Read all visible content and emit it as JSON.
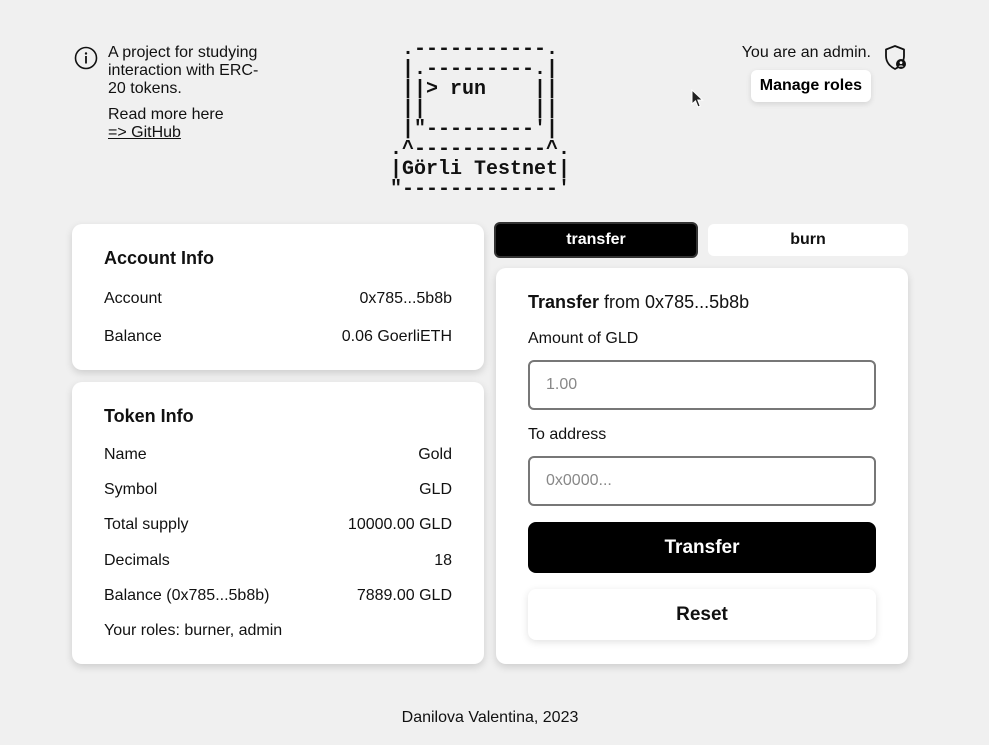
{
  "header": {
    "info_text": "A project for studying interaction with ERC-20 tokens.",
    "read_more": "Read more here",
    "github_link": "=> GitHub",
    "logo_ascii": " .-----------.\n |.---------.|\n ||> run    ||\n ||         ||\n |\"---------'|\n.^-----------^.\n|Görli Testnet|\n\"-------------'",
    "admin_text": "You are an admin.",
    "manage_roles": "Manage roles"
  },
  "account_info": {
    "title": "Account Info",
    "rows": [
      {
        "label": "Account",
        "value": "0x785...5b8b"
      },
      {
        "label": "Balance",
        "value": "0.06 GoerliETH"
      }
    ]
  },
  "token_info": {
    "title": "Token Info",
    "rows": [
      {
        "label": "Name",
        "value": "Gold"
      },
      {
        "label": "Symbol",
        "value": "GLD"
      },
      {
        "label": "Total supply",
        "value": "10000.00 GLD"
      },
      {
        "label": "Decimals",
        "value": "18"
      },
      {
        "label": "Balance (0x785...5b8b)",
        "value": "7889.00 GLD"
      }
    ],
    "roles": "Your roles: burner, admin"
  },
  "tabs": {
    "transfer": "transfer",
    "burn": "burn"
  },
  "transfer_form": {
    "heading_bold": "Transfer",
    "heading_rest": " from 0x785...5b8b",
    "amount_label": "Amount of GLD",
    "amount_placeholder": "1.00",
    "address_label": "To address",
    "address_placeholder": "0x0000...",
    "submit": "Transfer",
    "reset": "Reset"
  },
  "footer": {
    "text": "Danilova Valentina, 2023"
  },
  "icons": {
    "info": "info-icon",
    "shield": "shield-user-icon",
    "cursor": "mouse-cursor-icon"
  }
}
